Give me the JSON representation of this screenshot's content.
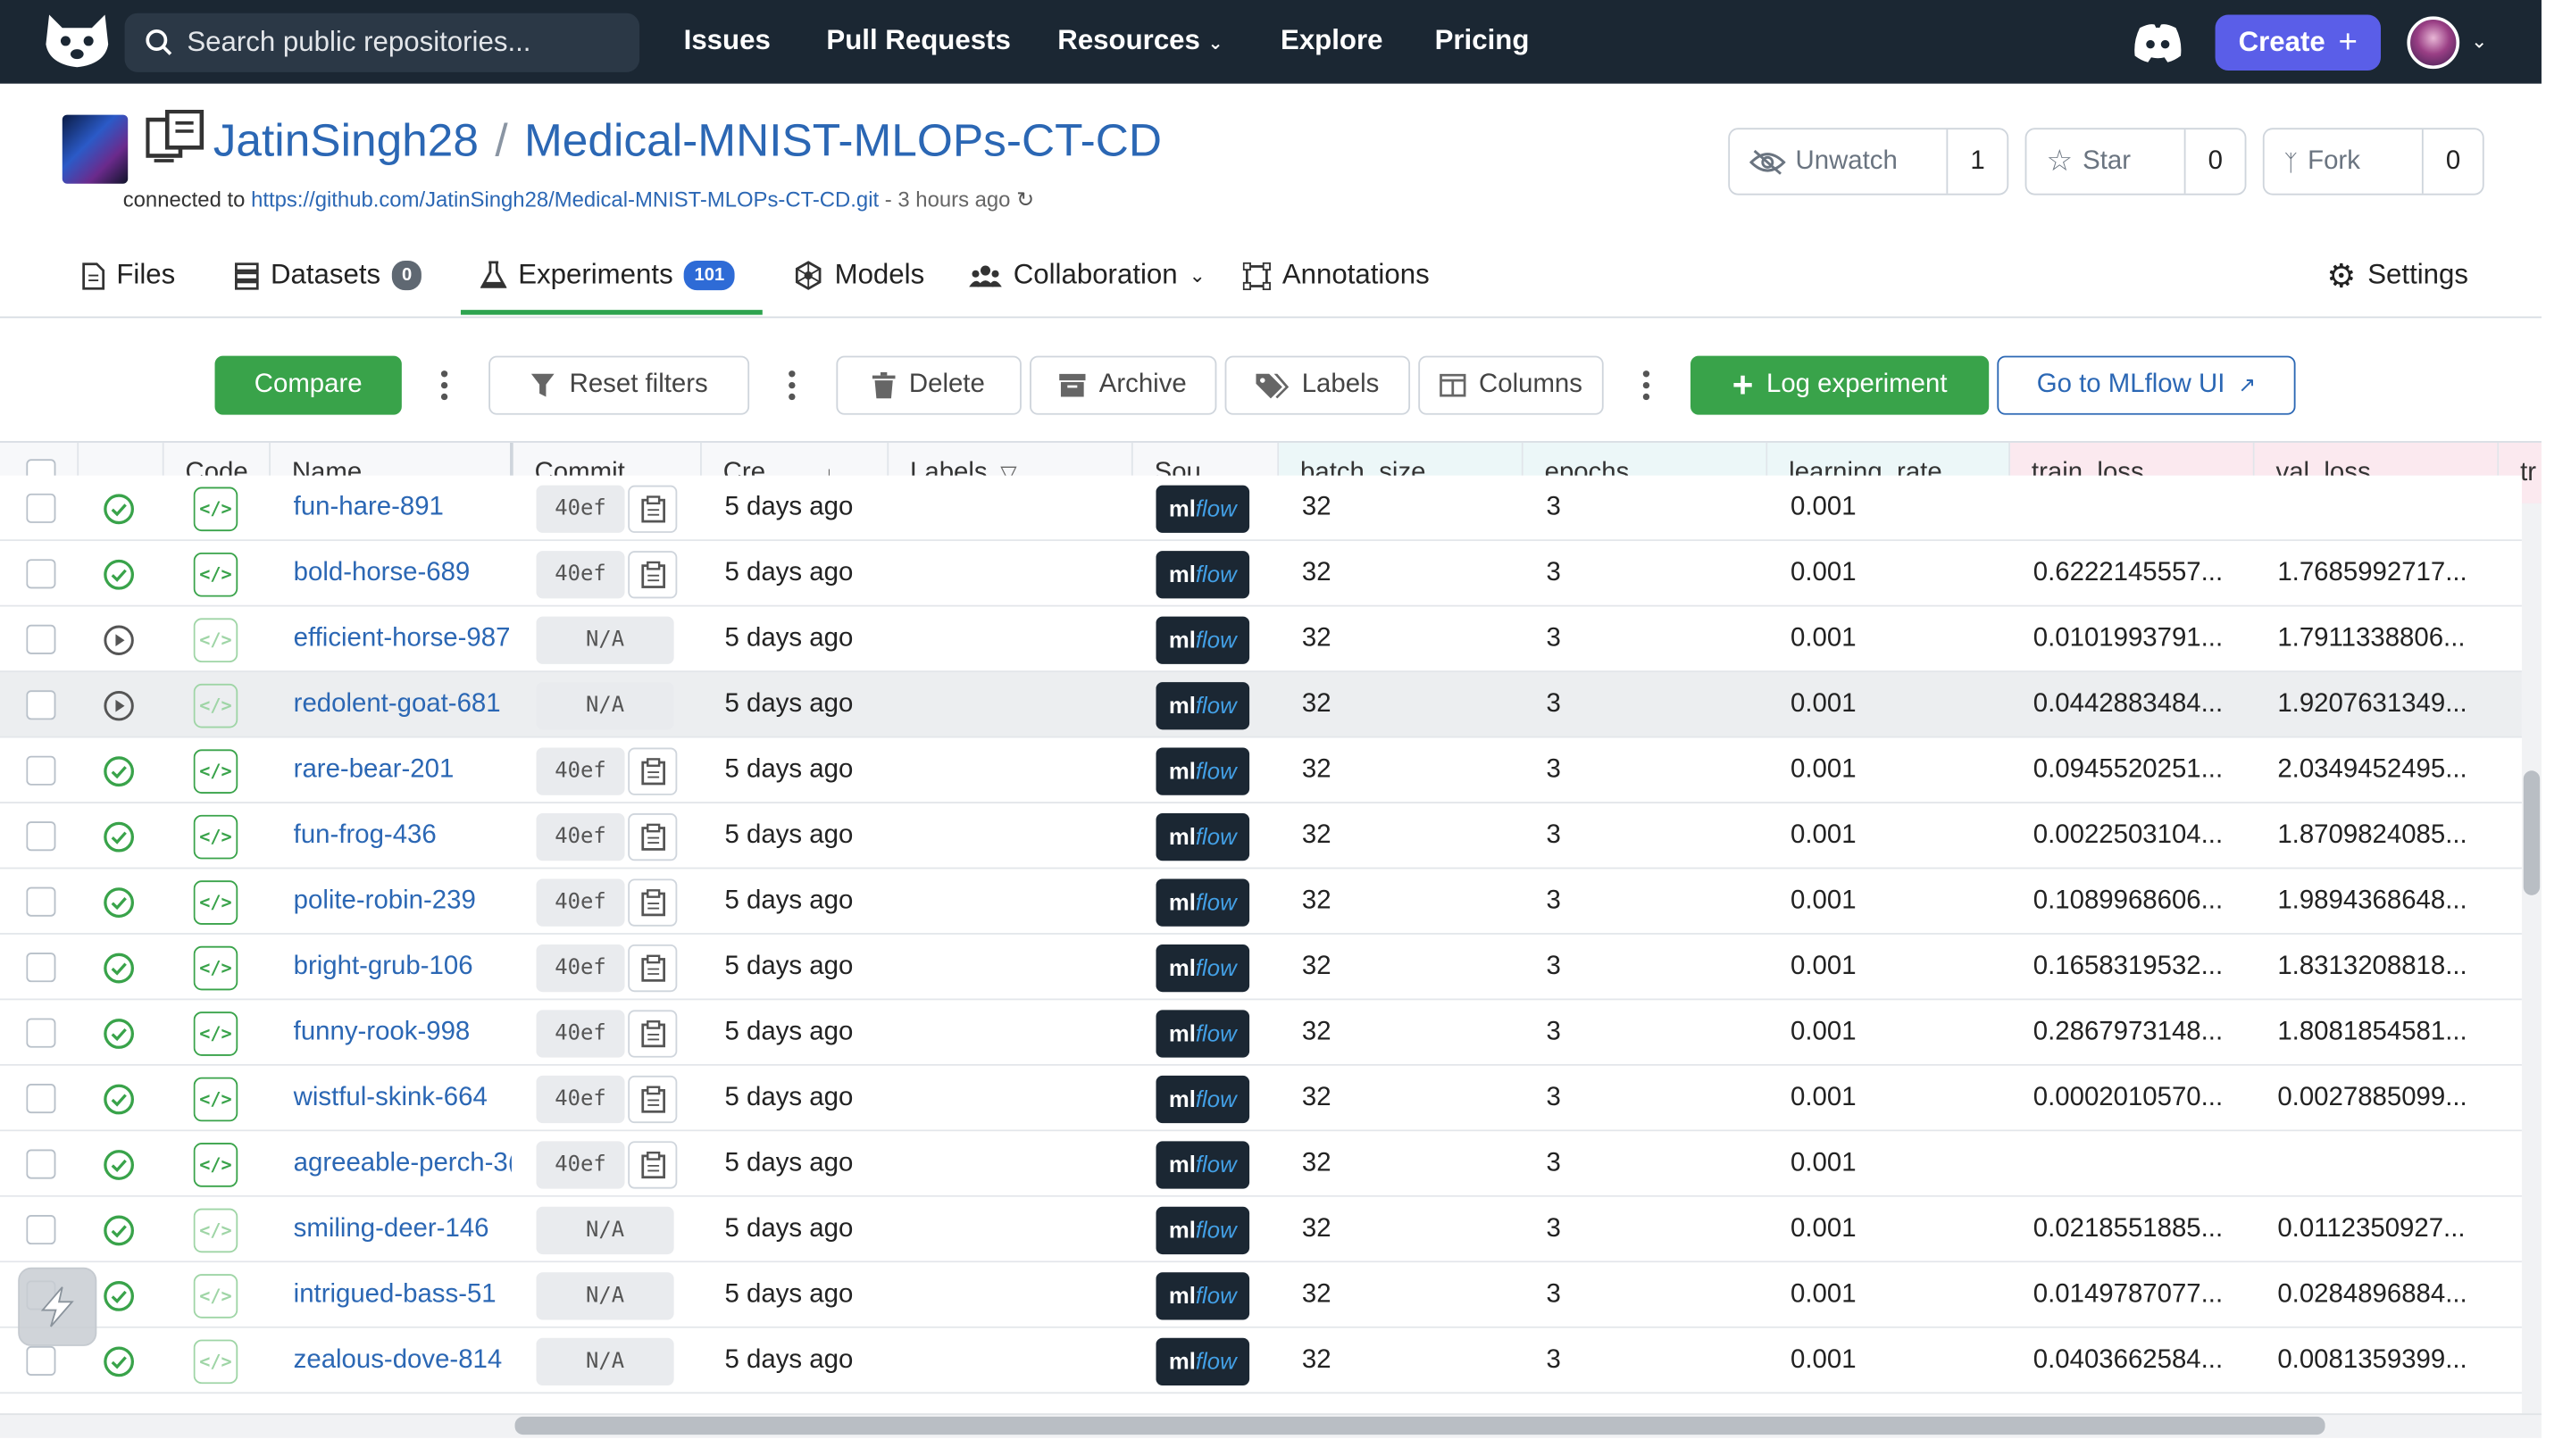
{
  "topbar": {
    "search_placeholder": "Search public repositories...",
    "nav": [
      "Issues",
      "Pull Requests",
      "Resources",
      "Explore",
      "Pricing"
    ],
    "create_label": "Create"
  },
  "repo": {
    "owner": "JatinSingh28",
    "name": "Medical-MNIST-MLOPs-CT-CD",
    "connected_prefix": "connected to",
    "connected_url": "https://github.com/JatinSingh28/Medical-MNIST-MLOPs-CT-CD.git",
    "updated": "- 3 hours ago",
    "unwatch_label": "Unwatch",
    "unwatch_count": "1",
    "star_label": "Star",
    "star_count": "0",
    "fork_label": "Fork",
    "fork_count": "0"
  },
  "tabs": {
    "files": "Files",
    "datasets": "Datasets",
    "datasets_count": "0",
    "experiments": "Experiments",
    "experiments_count": "101",
    "models": "Models",
    "collaboration": "Collaboration",
    "annotations": "Annotations",
    "settings": "Settings"
  },
  "toolbar": {
    "compare": "Compare",
    "reset_filters": "Reset filters",
    "delete": "Delete",
    "archive": "Archive",
    "labels": "Labels",
    "columns": "Columns",
    "log_experiment": "Log experiment",
    "mlflow_ui": "Go to MLflow UI"
  },
  "table": {
    "headers": {
      "code": "Code",
      "name": "Name",
      "commit": "Commit",
      "created": "Cre...",
      "labels": "Labels",
      "source": "Sou...",
      "batch_size": "batch_size",
      "epochs": "epochs",
      "learning_rate": "learning_rate",
      "train_loss": "train_loss",
      "val_loss": "val_loss",
      "extra": "tr"
    },
    "rows": [
      {
        "status": "done",
        "code": "full",
        "name": "fun-hare-891",
        "commit": "40ef",
        "created": "5 days ago",
        "batch_size": "32",
        "epochs": "3",
        "lr": "0.001",
        "train_loss": "",
        "val_loss": ""
      },
      {
        "status": "done",
        "code": "full",
        "name": "bold-horse-689",
        "commit": "40ef",
        "created": "5 days ago",
        "batch_size": "32",
        "epochs": "3",
        "lr": "0.001",
        "train_loss": "0.6222145557...",
        "val_loss": "1.7685992717..."
      },
      {
        "status": "running",
        "code": "faded",
        "name": "efficient-horse-987",
        "commit": "N/A",
        "created": "5 days ago",
        "batch_size": "32",
        "epochs": "3",
        "lr": "0.001",
        "train_loss": "0.0101993791...",
        "val_loss": "1.7911338806..."
      },
      {
        "status": "running",
        "code": "faded",
        "name": "redolent-goat-681",
        "commit": "N/A",
        "created": "5 days ago",
        "batch_size": "32",
        "epochs": "3",
        "lr": "0.001",
        "train_loss": "0.0442883484...",
        "val_loss": "1.9207631349..."
      },
      {
        "status": "done",
        "code": "full",
        "name": "rare-bear-201",
        "commit": "40ef",
        "created": "5 days ago",
        "batch_size": "32",
        "epochs": "3",
        "lr": "0.001",
        "train_loss": "0.0945520251...",
        "val_loss": "2.0349452495..."
      },
      {
        "status": "done",
        "code": "full",
        "name": "fun-frog-436",
        "commit": "40ef",
        "created": "5 days ago",
        "batch_size": "32",
        "epochs": "3",
        "lr": "0.001",
        "train_loss": "0.0022503104...",
        "val_loss": "1.8709824085..."
      },
      {
        "status": "done",
        "code": "full",
        "name": "polite-robin-239",
        "commit": "40ef",
        "created": "5 days ago",
        "batch_size": "32",
        "epochs": "3",
        "lr": "0.001",
        "train_loss": "0.1089968606...",
        "val_loss": "1.9894368648..."
      },
      {
        "status": "done",
        "code": "full",
        "name": "bright-grub-106",
        "commit": "40ef",
        "created": "5 days ago",
        "batch_size": "32",
        "epochs": "3",
        "lr": "0.001",
        "train_loss": "0.1658319532...",
        "val_loss": "1.8313208818..."
      },
      {
        "status": "done",
        "code": "full",
        "name": "funny-rook-998",
        "commit": "40ef",
        "created": "5 days ago",
        "batch_size": "32",
        "epochs": "3",
        "lr": "0.001",
        "train_loss": "0.2867973148...",
        "val_loss": "1.8081854581..."
      },
      {
        "status": "done",
        "code": "full",
        "name": "wistful-skink-664",
        "commit": "40ef",
        "created": "5 days ago",
        "batch_size": "32",
        "epochs": "3",
        "lr": "0.001",
        "train_loss": "0.0002010570...",
        "val_loss": "0.0027885099..."
      },
      {
        "status": "done",
        "code": "full",
        "name": "agreeable-perch-3(",
        "commit": "40ef",
        "created": "5 days ago",
        "batch_size": "32",
        "epochs": "3",
        "lr": "0.001",
        "train_loss": "",
        "val_loss": ""
      },
      {
        "status": "done",
        "code": "faded",
        "name": "smiling-deer-146",
        "commit": "N/A",
        "created": "5 days ago",
        "batch_size": "32",
        "epochs": "3",
        "lr": "0.001",
        "train_loss": "0.0218551885...",
        "val_loss": "0.0112350927..."
      },
      {
        "status": "done",
        "code": "faded",
        "name": "intrigued-bass-51",
        "commit": "N/A",
        "created": "5 days ago",
        "batch_size": "32",
        "epochs": "3",
        "lr": "0.001",
        "train_loss": "0.0149787077...",
        "val_loss": "0.0284896884..."
      },
      {
        "status": "done",
        "code": "faded",
        "name": "zealous-dove-814",
        "commit": "N/A",
        "created": "5 days ago",
        "batch_size": "32",
        "epochs": "3",
        "lr": "0.001",
        "train_loss": "0.0403662584...",
        "val_loss": "0.0081359399..."
      }
    ],
    "source_label_ml": "ml",
    "source_label_flow": "flow"
  },
  "colors": {
    "topbar": "#1b2733",
    "accent_green": "#39a34a",
    "link_blue": "#2b67b4",
    "create_purple": "#5a5ee8"
  }
}
